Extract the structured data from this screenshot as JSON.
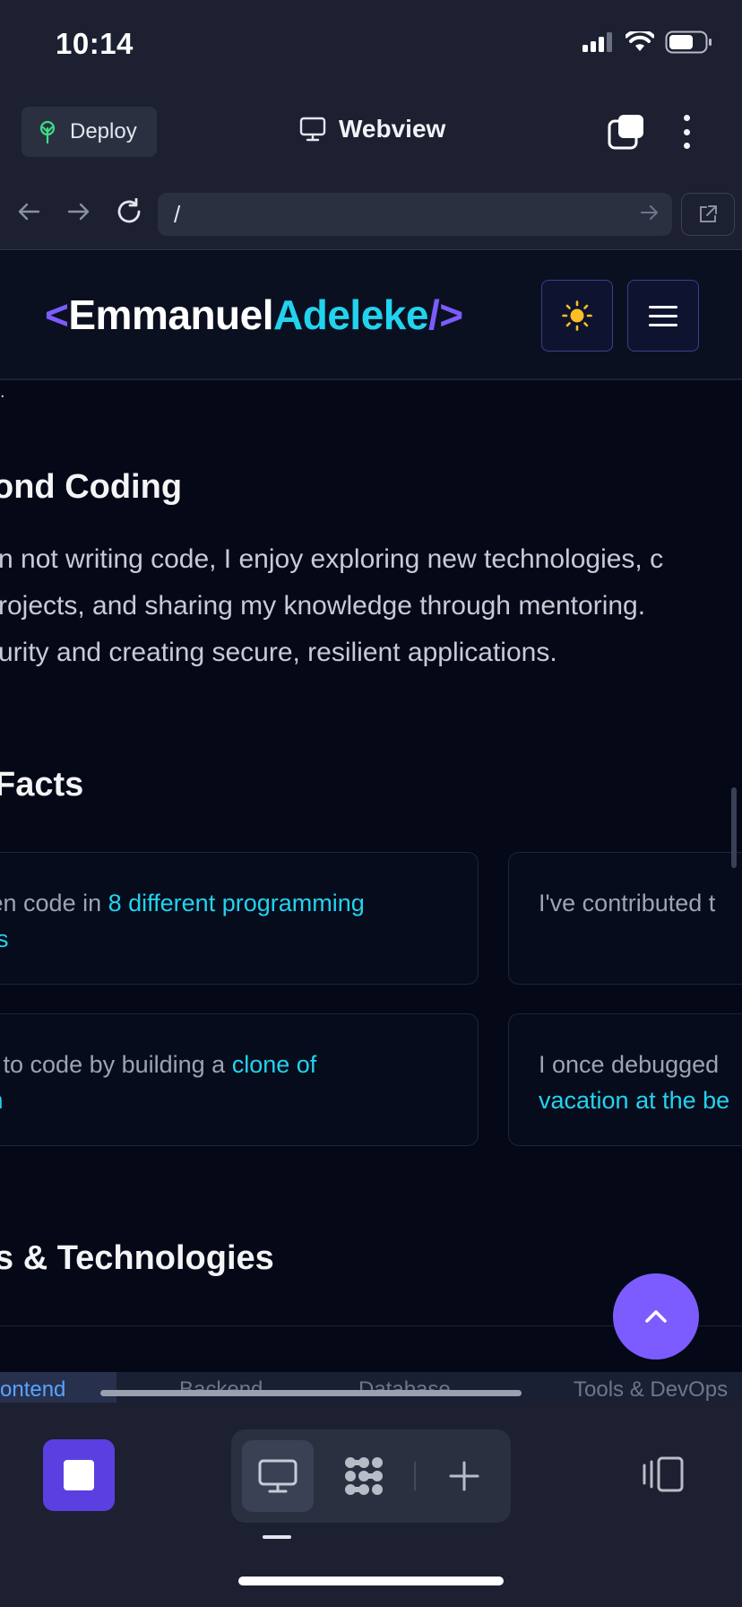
{
  "status_bar": {
    "time": "10:14"
  },
  "top_bar": {
    "deploy_label": "Deploy",
    "webview_label": "Webview"
  },
  "url_bar": {
    "path": "/"
  },
  "site": {
    "logo": {
      "open": "<",
      "first": "Emmanuel",
      "last": "Adeleke",
      "close": "/>"
    },
    "about": {
      "fragment": ".",
      "heading": "ond Coding",
      "lines": [
        "n not writing code, I enjoy exploring new technologies, c",
        "rojects, and sharing my knowledge through mentoring.",
        "urity and creating secure, resilient applications."
      ]
    },
    "facts": {
      "heading": "Facts",
      "cards": [
        {
          "pre": "ten code in ",
          "highlight": "8 different programming",
          "line2": "es"
        },
        {
          "pre": "I've contributed t",
          "highlight": "",
          "line2": ""
        },
        {
          "pre": "d to code by building a ",
          "highlight": "clone of",
          "line2": "m"
        },
        {
          "pre": "I once debugged",
          "highlight": "",
          "line2": "vacation at the be"
        }
      ]
    },
    "skills": {
      "heading": "s & Technologies",
      "tabs": [
        "rontend",
        "Backend",
        "Database",
        "Tools & DevOps"
      ]
    }
  },
  "colors": {
    "accent_purple": "#7c5cff",
    "accent_cyan": "#22d3ee",
    "page_bg": "#050816",
    "chrome_bg": "#1c2030"
  },
  "icons": [
    "signal-icon",
    "wifi-icon",
    "battery-icon",
    "deploy-icon",
    "monitor-icon",
    "tabs-icon",
    "more-icon",
    "back-arrow-icon",
    "forward-arrow-icon",
    "reload-icon",
    "go-arrow-icon",
    "external-link-icon",
    "sun-icon",
    "hamburger-icon",
    "chevron-up-icon",
    "stop-icon",
    "desktop-icon",
    "apps-icon",
    "plus-icon",
    "side-panel-icon"
  ]
}
